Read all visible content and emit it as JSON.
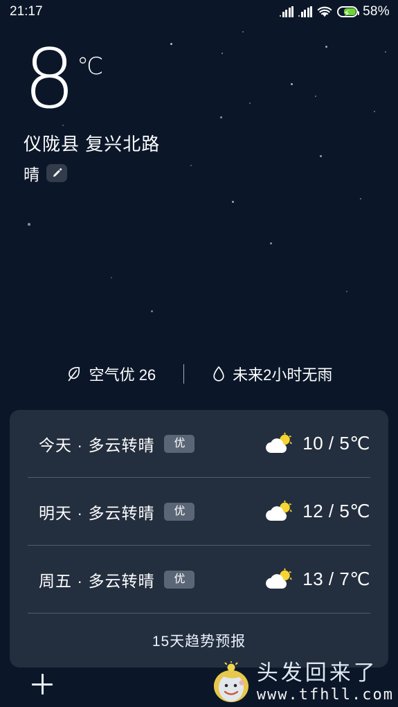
{
  "status_bar": {
    "time": "21:17",
    "battery_percent": "58%",
    "signal_icon": "signal-bars-icon",
    "signal_icon_2": "signal-bars-icon",
    "wifi_icon": "wifi-icon",
    "battery_icon": "battery-charging-icon"
  },
  "hero": {
    "temperature": "8",
    "unit": "℃",
    "location": "仪陇县  复兴北路",
    "condition": "晴",
    "edit_icon": "pencil-edit-icon"
  },
  "info": {
    "air_icon": "leaf-icon",
    "air_text": "空气优 26",
    "rain_icon": "water-drop-icon",
    "rain_text": "未来2小时无雨"
  },
  "forecast": {
    "rows": [
      {
        "day": "今天 · 多云转晴",
        "badge": "优",
        "icon": "sun-behind-cloud-icon",
        "temp": "10 / 5℃"
      },
      {
        "day": "明天 · 多云转晴",
        "badge": "优",
        "icon": "sun-behind-cloud-icon",
        "temp": "12 / 5℃"
      },
      {
        "day": "周五 · 多云转晴",
        "badge": "优",
        "icon": "sun-behind-cloud-icon",
        "temp": "13 / 7℃"
      }
    ],
    "trend_label": "15天趋势预报"
  },
  "bottom_bar": {
    "add_label": "+",
    "add_icon": "plus-icon"
  },
  "watermark": {
    "logo_icon": "cartoon-face-logo",
    "title": "头发回来了",
    "url": "www.tfhll.com"
  },
  "colors": {
    "accent_green": "#6bd334",
    "sun_yellow": "#f5d32e",
    "card_bg": "rgba(255,255,255,0.10)",
    "sky_top": "#0c1526",
    "sky_bottom": "#4b84c6"
  }
}
